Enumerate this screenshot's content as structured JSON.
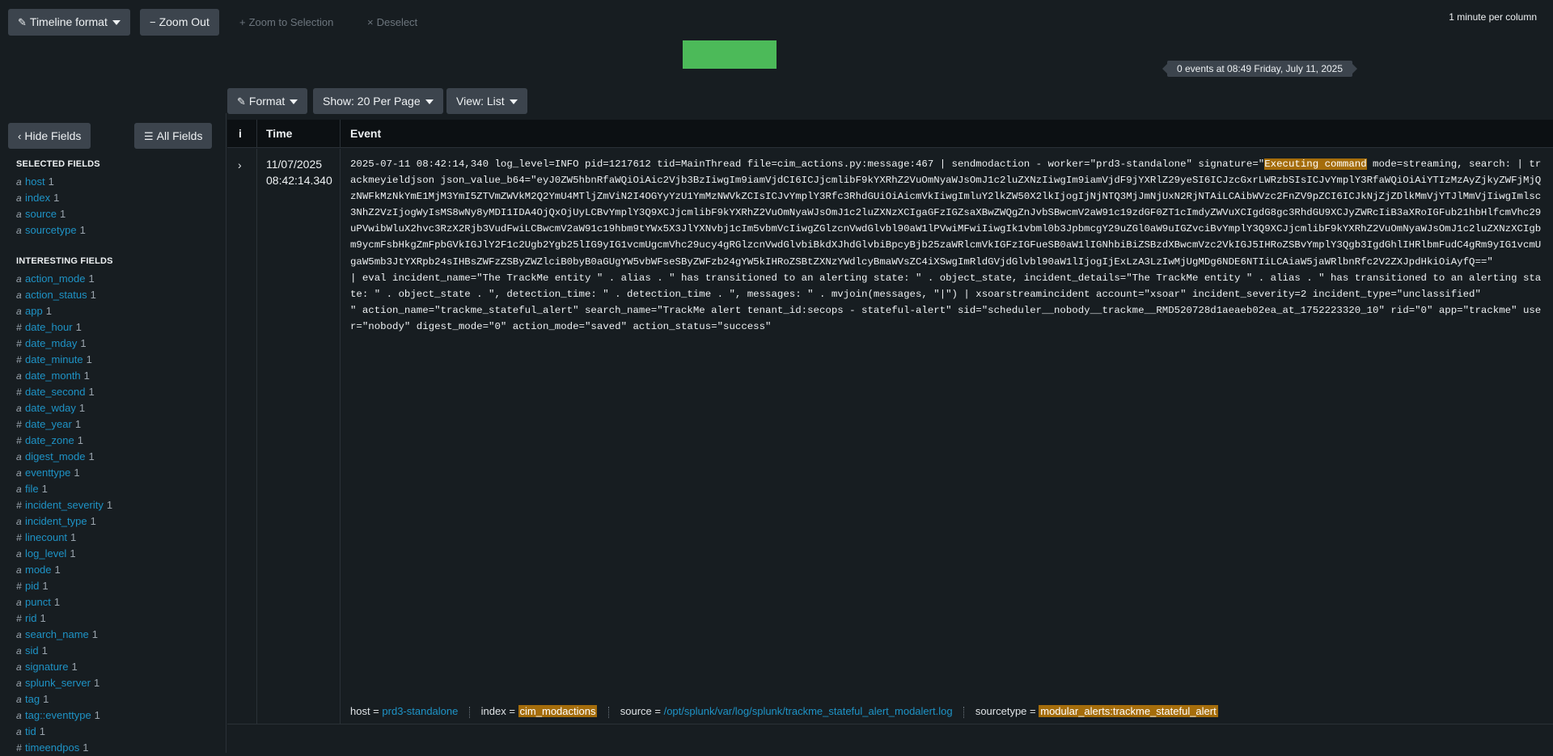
{
  "toolbar": {
    "timeline_format": "Timeline format",
    "zoom_out": "Zoom Out",
    "zoom_to_selection": "Zoom to Selection",
    "deselect": "Deselect",
    "per_column": "1 minute per column"
  },
  "timeline": {
    "tooltip": "0 events at 08:49 Friday, July 11, 2025",
    "bar_color": "#4cba59"
  },
  "results_toolbar": {
    "format": "Format",
    "show_per_page": "Show: 20 Per Page",
    "view": "View: List"
  },
  "sidebar": {
    "hide_fields": "Hide Fields",
    "all_fields": "All Fields",
    "selected_heading": "SELECTED FIELDS",
    "selected": [
      {
        "type": "a",
        "name": "host",
        "count": "1"
      },
      {
        "type": "a",
        "name": "index",
        "count": "1"
      },
      {
        "type": "a",
        "name": "source",
        "count": "1"
      },
      {
        "type": "a",
        "name": "sourcetype",
        "count": "1"
      }
    ],
    "interesting_heading": "INTERESTING FIELDS",
    "interesting": [
      {
        "type": "a",
        "name": "action_mode",
        "count": "1"
      },
      {
        "type": "a",
        "name": "action_status",
        "count": "1"
      },
      {
        "type": "a",
        "name": "app",
        "count": "1"
      },
      {
        "type": "#",
        "name": "date_hour",
        "count": "1"
      },
      {
        "type": "#",
        "name": "date_mday",
        "count": "1"
      },
      {
        "type": "#",
        "name": "date_minute",
        "count": "1"
      },
      {
        "type": "a",
        "name": "date_month",
        "count": "1"
      },
      {
        "type": "#",
        "name": "date_second",
        "count": "1"
      },
      {
        "type": "a",
        "name": "date_wday",
        "count": "1"
      },
      {
        "type": "#",
        "name": "date_year",
        "count": "1"
      },
      {
        "type": "#",
        "name": "date_zone",
        "count": "1"
      },
      {
        "type": "a",
        "name": "digest_mode",
        "count": "1"
      },
      {
        "type": "a",
        "name": "eventtype",
        "count": "1"
      },
      {
        "type": "a",
        "name": "file",
        "count": "1"
      },
      {
        "type": "#",
        "name": "incident_severity",
        "count": "1"
      },
      {
        "type": "a",
        "name": "incident_type",
        "count": "1"
      },
      {
        "type": "#",
        "name": "linecount",
        "count": "1"
      },
      {
        "type": "a",
        "name": "log_level",
        "count": "1"
      },
      {
        "type": "a",
        "name": "mode",
        "count": "1"
      },
      {
        "type": "#",
        "name": "pid",
        "count": "1"
      },
      {
        "type": "a",
        "name": "punct",
        "count": "1"
      },
      {
        "type": "#",
        "name": "rid",
        "count": "1"
      },
      {
        "type": "a",
        "name": "search_name",
        "count": "1"
      },
      {
        "type": "a",
        "name": "sid",
        "count": "1"
      },
      {
        "type": "a",
        "name": "signature",
        "count": "1"
      },
      {
        "type": "a",
        "name": "splunk_server",
        "count": "1"
      },
      {
        "type": "a",
        "name": "tag",
        "count": "1"
      },
      {
        "type": "a",
        "name": "tag::eventtype",
        "count": "1"
      },
      {
        "type": "a",
        "name": "tid",
        "count": "1"
      },
      {
        "type": "#",
        "name": "timeendpos",
        "count": "1"
      }
    ]
  },
  "table": {
    "col_info": "i",
    "col_time": "Time",
    "col_event": "Event"
  },
  "event": {
    "date": "11/07/2025",
    "time": "08:42:14.340",
    "raw_prefix": "2025-07-11 08:42:14,340 log_level=INFO pid=1217612 tid=MainThread file=cim_actions.py:message:467 | sendmodaction - worker=\"prd3-standalone\" signature=\"",
    "raw_highlight": "Executing command",
    "raw_suffix": " mode=streaming, search: | trackmeyieldjson json_value_b64=\"eyJ0ZW5hbnRfaWQiOiAic2Vjb3BzIiwgIm9iamVjdCI6ICJjcmlibF9kYXRhZ2VuOmNyaWJsOmJ1c2luZXNzIiwgIm9iamVjdF9jYXRlZ29yeSI6ICJzcGxrLWRzbSIsICJvYmplY3RfaWQiOiAiYTIzMzAyZjkyZWFjMjQzNWFkMzNkYmE1MjM3YmI5ZTVmZWVkM2Q2YmU4MTljZmViN2I4OGYyYzU1YmMzNWVkZCIsICJvYmplY3Rfc3RhdGUiOiAicmVkIiwgImluY2lkZW50X2lkIjogIjNjNTQ3MjJmNjUxN2RjNTAiLCAibWVzc2FnZV9pZCI6ICJkNjZjZDlkMmVjYTJlMmVjIiwgImlsc3NhZ2VzIjogWyIsMS8wNy8yMDI1IDA4OjQxOjUyLCBvYmplY3Q9XCJjcmlibF9kYXRhZ2VuOmNyaWJsOmJ1c2luZXNzXCIgaGFzIGZsaXBwZWQgZnJvbSBwcmV2aW91c19zdGF0ZT1cImdyZWVuXCIgdG8gc3RhdGU9XCJyZWRcIiB3aXRoIGFub21hbHlfcmVhc29uPVwibWluX2hvc3RzX2Rjb3VudFwiLCBwcmV2aW91c19hbm9tYWx5X3JlYXNvbj1cIm5vbmVcIiwgZGlzcnVwdGlvbl90aW1lPVwiMFwiIiwgIk1vbml0b3JpbmcgY29uZGl0aW9uIGZvciBvYmplY3Q9XCJjcmlibF9kYXRhZ2VuOmNyaWJsOmJ1c2luZXNzXCIgbm9ycmFsbHkgZmFpbGVkIGJlY2F1c2Ugb2Ygb25lIG9yIG1vcmUgcmVhc29ucy4gRGlzcnVwdGlvbiBkdXJhdGlvbiBpcyBjb25zaWRlcmVkIGFzIGFueSB0aW1lIGNhbiBiZSBzdXBwcmVzc2VkIGJ5IHRoZSBvYmplY3Qgb3IgdGhlIHRlbmFudC4gRm9yIG1vcmUgaW5mb3JtYXRpb24sIHBsZWFzZSByZWZlciB0byB0aGUgYW5vbWFseSByZWFzb24gYW5kIHRoZSBtZXNzYWdlcyBmaWVsZC4iXSwgImRldGVjdGlvbl90aW1lIjogIjExLzA3LzIwMjUgMDg6NDE6NTIiLCAiaW5jaWRlbnRfc2V2ZXJpdHkiOiAyfQ==\"\n| eval incident_name=\"The TrackMe entity \" . alias . \" has transitioned to an alerting state: \" . object_state, incident_details=\"The TrackMe entity \" . alias . \" has transitioned to an alerting state: \" . object_state . \", detection_time: \" . detection_time . \", messages: \" . mvjoin(messages, \"|\") | xsoarstreamincident account=\"xsoar\" incident_severity=2 incident_type=\"unclassified\"\n\" action_name=\"trackme_stateful_alert\" search_name=\"TrackMe alert tenant_id:secops - stateful-alert\" sid=\"scheduler__nobody__trackme__RMD520728d1aeaeb02ea_at_1752223320_10\" rid=\"0\" app=\"trackme\" user=\"nobody\" digest_mode=\"0\" action_mode=\"saved\" action_status=\"success\"",
    "meta": {
      "host_label": "host =",
      "host": "prd3-standalone",
      "index_label": "index =",
      "index": "cim_modactions",
      "source_label": "source =",
      "source": "/opt/splunk/var/log/splunk/trackme_stateful_alert_modalert.log",
      "sourcetype_label": "sourcetype =",
      "sourcetype": "modular_alerts:trackme_stateful_alert"
    }
  },
  "colors": {
    "accent": "#0877a6",
    "link": "#1e93c6",
    "highlight": "#a56d0b"
  }
}
